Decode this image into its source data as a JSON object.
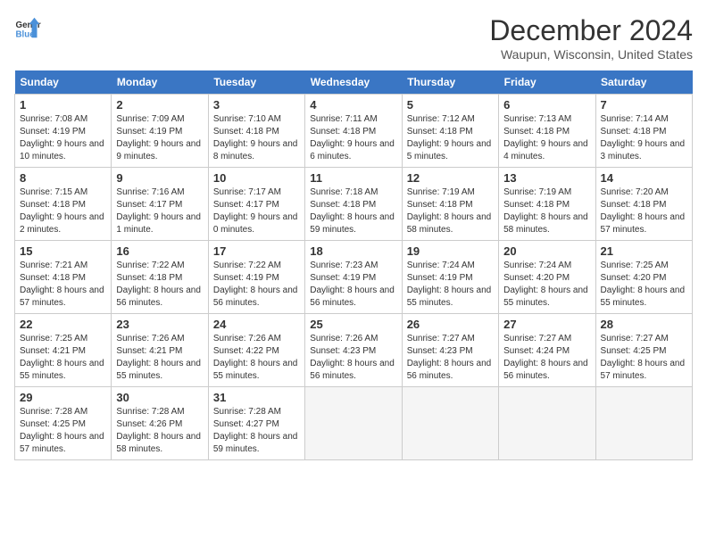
{
  "header": {
    "logo_line1": "General",
    "logo_line2": "Blue",
    "month_title": "December 2024",
    "location": "Waupun, Wisconsin, United States"
  },
  "days_of_week": [
    "Sunday",
    "Monday",
    "Tuesday",
    "Wednesday",
    "Thursday",
    "Friday",
    "Saturday"
  ],
  "weeks": [
    [
      {
        "day": "1",
        "sunrise": "7:08 AM",
        "sunset": "4:19 PM",
        "daylight": "9 hours and 10 minutes."
      },
      {
        "day": "2",
        "sunrise": "7:09 AM",
        "sunset": "4:19 PM",
        "daylight": "9 hours and 9 minutes."
      },
      {
        "day": "3",
        "sunrise": "7:10 AM",
        "sunset": "4:18 PM",
        "daylight": "9 hours and 8 minutes."
      },
      {
        "day": "4",
        "sunrise": "7:11 AM",
        "sunset": "4:18 PM",
        "daylight": "9 hours and 6 minutes."
      },
      {
        "day": "5",
        "sunrise": "7:12 AM",
        "sunset": "4:18 PM",
        "daylight": "9 hours and 5 minutes."
      },
      {
        "day": "6",
        "sunrise": "7:13 AM",
        "sunset": "4:18 PM",
        "daylight": "9 hours and 4 minutes."
      },
      {
        "day": "7",
        "sunrise": "7:14 AM",
        "sunset": "4:18 PM",
        "daylight": "9 hours and 3 minutes."
      }
    ],
    [
      {
        "day": "8",
        "sunrise": "7:15 AM",
        "sunset": "4:18 PM",
        "daylight": "9 hours and 2 minutes."
      },
      {
        "day": "9",
        "sunrise": "7:16 AM",
        "sunset": "4:17 PM",
        "daylight": "9 hours and 1 minute."
      },
      {
        "day": "10",
        "sunrise": "7:17 AM",
        "sunset": "4:17 PM",
        "daylight": "9 hours and 0 minutes."
      },
      {
        "day": "11",
        "sunrise": "7:18 AM",
        "sunset": "4:18 PM",
        "daylight": "8 hours and 59 minutes."
      },
      {
        "day": "12",
        "sunrise": "7:19 AM",
        "sunset": "4:18 PM",
        "daylight": "8 hours and 58 minutes."
      },
      {
        "day": "13",
        "sunrise": "7:19 AM",
        "sunset": "4:18 PM",
        "daylight": "8 hours and 58 minutes."
      },
      {
        "day": "14",
        "sunrise": "7:20 AM",
        "sunset": "4:18 PM",
        "daylight": "8 hours and 57 minutes."
      }
    ],
    [
      {
        "day": "15",
        "sunrise": "7:21 AM",
        "sunset": "4:18 PM",
        "daylight": "8 hours and 57 minutes."
      },
      {
        "day": "16",
        "sunrise": "7:22 AM",
        "sunset": "4:18 PM",
        "daylight": "8 hours and 56 minutes."
      },
      {
        "day": "17",
        "sunrise": "7:22 AM",
        "sunset": "4:19 PM",
        "daylight": "8 hours and 56 minutes."
      },
      {
        "day": "18",
        "sunrise": "7:23 AM",
        "sunset": "4:19 PM",
        "daylight": "8 hours and 56 minutes."
      },
      {
        "day": "19",
        "sunrise": "7:24 AM",
        "sunset": "4:19 PM",
        "daylight": "8 hours and 55 minutes."
      },
      {
        "day": "20",
        "sunrise": "7:24 AM",
        "sunset": "4:20 PM",
        "daylight": "8 hours and 55 minutes."
      },
      {
        "day": "21",
        "sunrise": "7:25 AM",
        "sunset": "4:20 PM",
        "daylight": "8 hours and 55 minutes."
      }
    ],
    [
      {
        "day": "22",
        "sunrise": "7:25 AM",
        "sunset": "4:21 PM",
        "daylight": "8 hours and 55 minutes."
      },
      {
        "day": "23",
        "sunrise": "7:26 AM",
        "sunset": "4:21 PM",
        "daylight": "8 hours and 55 minutes."
      },
      {
        "day": "24",
        "sunrise": "7:26 AM",
        "sunset": "4:22 PM",
        "daylight": "8 hours and 55 minutes."
      },
      {
        "day": "25",
        "sunrise": "7:26 AM",
        "sunset": "4:23 PM",
        "daylight": "8 hours and 56 minutes."
      },
      {
        "day": "26",
        "sunrise": "7:27 AM",
        "sunset": "4:23 PM",
        "daylight": "8 hours and 56 minutes."
      },
      {
        "day": "27",
        "sunrise": "7:27 AM",
        "sunset": "4:24 PM",
        "daylight": "8 hours and 56 minutes."
      },
      {
        "day": "28",
        "sunrise": "7:27 AM",
        "sunset": "4:25 PM",
        "daylight": "8 hours and 57 minutes."
      }
    ],
    [
      {
        "day": "29",
        "sunrise": "7:28 AM",
        "sunset": "4:25 PM",
        "daylight": "8 hours and 57 minutes."
      },
      {
        "day": "30",
        "sunrise": "7:28 AM",
        "sunset": "4:26 PM",
        "daylight": "8 hours and 58 minutes."
      },
      {
        "day": "31",
        "sunrise": "7:28 AM",
        "sunset": "4:27 PM",
        "daylight": "8 hours and 59 minutes."
      },
      null,
      null,
      null,
      null
    ]
  ]
}
